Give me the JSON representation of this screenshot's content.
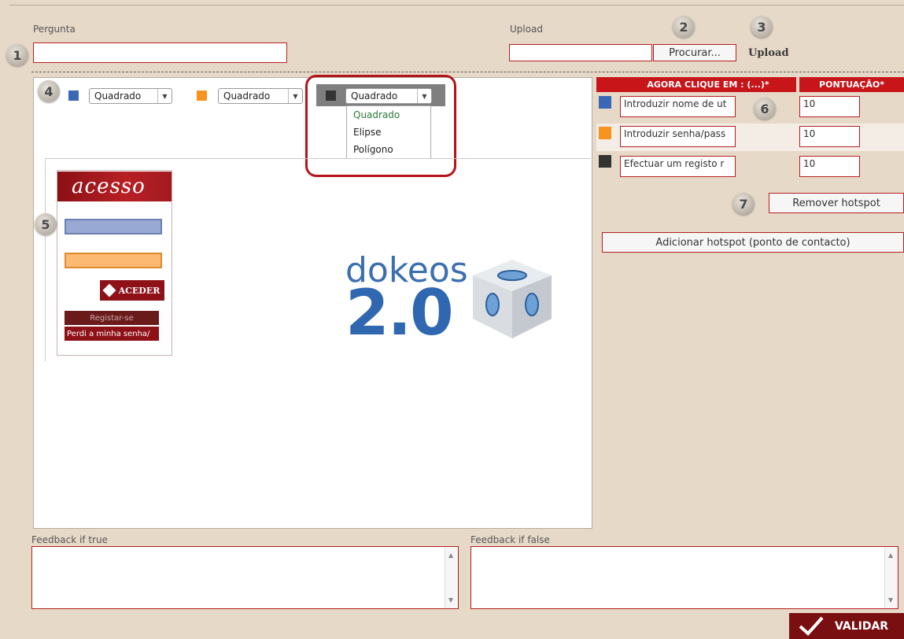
{
  "question": {
    "label": "Pergunta",
    "value": ""
  },
  "upload": {
    "label": "Upload",
    "value": "",
    "browse_button": "Procurar...",
    "upload_link": "Upload"
  },
  "badges": [
    "1",
    "2",
    "3",
    "4",
    "5",
    "6",
    "7"
  ],
  "shape_selectors": [
    {
      "color": "#3a68b5",
      "selected": "Quadrado"
    },
    {
      "color": "#f7931e",
      "selected": "Quadrado"
    },
    {
      "color": "#333333",
      "selected": "Quadrado"
    }
  ],
  "shape_dropdown_options": [
    "Quadrado",
    "Elipse",
    "Polígono"
  ],
  "login_widget": {
    "logo": "acesso",
    "button": "ACEDER",
    "register": "Registar-se",
    "forgot": "Perdi a minha senha/"
  },
  "dokeos_logo": {
    "word": "dokeos",
    "version": "2.0"
  },
  "hotspot_table": {
    "header_click": "AGORA CLIQUE EM : (...)*",
    "header_score": "PONTUAÇÃO*",
    "rows": [
      {
        "color": "#3a68b5",
        "label": "Introduzir nome de ut",
        "score": "10"
      },
      {
        "color": "#f7931e",
        "label": "Introduzir senha/pass",
        "score": "10"
      },
      {
        "color": "#333333",
        "label": "Efectuar um registo r",
        "score": "10"
      }
    ]
  },
  "remove_hotspot": "Remover hotspot",
  "add_hotspot": "Adicionar hotspot (ponto de contacto)",
  "feedback_true": {
    "label": "Feedback if true",
    "value": ""
  },
  "feedback_false": {
    "label": "Feedback if false",
    "value": ""
  },
  "validate_button": "VALIDAR",
  "colors": {
    "accent": "#b51f1f",
    "header_red": "#c7151a",
    "bg": "#e7d9c8",
    "highlight": "#b3141b"
  }
}
